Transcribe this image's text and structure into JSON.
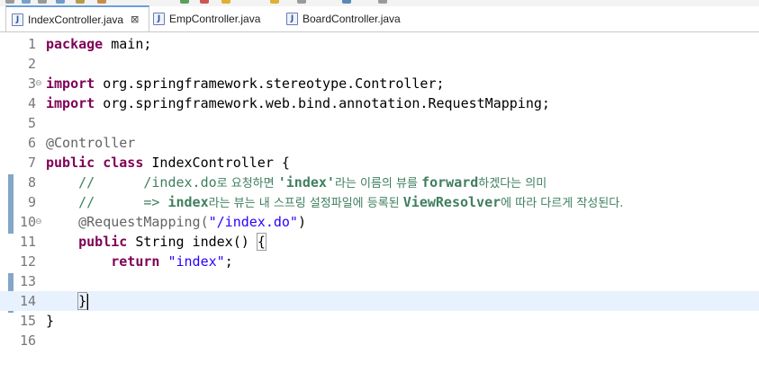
{
  "tabs": [
    {
      "label": "IndexController.java",
      "active": true,
      "icon": "java-file-icon",
      "close": "⊠"
    },
    {
      "label": "EmpController.java",
      "active": false,
      "icon": "java-file-icon"
    },
    {
      "label": "BoardController.java",
      "active": false,
      "icon": "java-file-icon"
    }
  ],
  "colors": {
    "keyword": "#7f0055",
    "string": "#2a00ff",
    "comment": "#3f7f5f",
    "annotation": "#646464",
    "current_line": "#e8f2fe"
  },
  "editor": {
    "line_numbers": [
      "1",
      "2",
      "3",
      "4",
      "5",
      "6",
      "7",
      "8",
      "9",
      "10",
      "11",
      "12",
      "13",
      "14",
      "15",
      "16"
    ],
    "lines": {
      "l1": {
        "kw": "package",
        "rest": " main;"
      },
      "l3": {
        "kw": "import",
        "rest": " org.springframework.stereotype.Controller;"
      },
      "l4": {
        "kw": "import",
        "rest": " org.springframework.web.bind.annotation.RequestMapping;"
      },
      "l6": {
        "anno": "@Controller"
      },
      "l7": {
        "kw1": "public",
        "kw2": "class",
        "rest": " IndexController {"
      },
      "l8": {
        "c1": "//      /index.do",
        "c2": "로 요청하면 ",
        "c3": "'index'",
        "c4": "라는 이름의 뷰를 ",
        "c5": "forward",
        "c6": "하겠다는 의미"
      },
      "l9": {
        "c1": "//      => ",
        "c2": "index",
        "c3": "라는 뷰는 내 스프링 설정파일에 등록된 ",
        "c4": "ViewResolver",
        "c5": "에 따라 다르게 작성된다."
      },
      "l10": {
        "anno": "@RequestMapping(",
        "str": "\"/index.do\"",
        "rest": ")"
      },
      "l11": {
        "kw": "public",
        "rest": " String index() ",
        "brace": "{"
      },
      "l12": {
        "kw": "return",
        "str": "\"index\"",
        "rest": ";"
      },
      "l14": {
        "brace": "}"
      },
      "l15": {
        "brace": "}"
      }
    }
  }
}
